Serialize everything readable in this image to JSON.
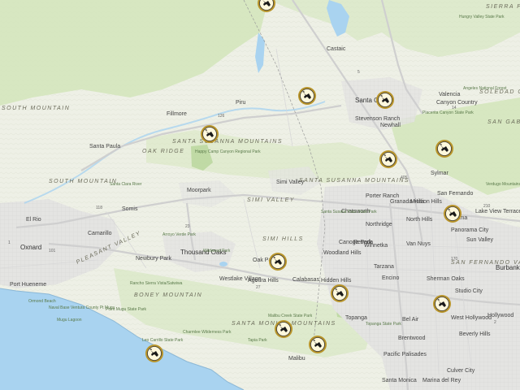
{
  "map": {
    "range_labels": [
      "SOUTH MOUNTAIN",
      "SANTA SUSANNA MOUNTAINS",
      "SOUTH MOUNTAIN",
      "SANTA SUSANNA MOUNTAINS",
      "SIMI VALLEY",
      "SIMI HILLS",
      "PLEASANT VALLEY",
      "BONEY MOUNTAIN",
      "SANTA MONICA MOUNTAINS",
      "SAN FERNANDO VALLEY",
      "SAN GABR",
      "SIERRA PELONA",
      "SOLEDAD CAN",
      "OAK RIDGE"
    ],
    "city_labels": [
      "Santa Paula",
      "Fillmore",
      "Piru",
      "Santa Clarita",
      "Stevenson Ranch",
      "Newhall",
      "Canyon Country",
      "Oxnard",
      "Camarillo",
      "Moorpark",
      "Simi Valley",
      "Somis",
      "El Rio",
      "Thousand Oaks",
      "Newbury Park",
      "Oak Park",
      "Agoura Hills",
      "Calabasas",
      "Hidden Hills",
      "Malibu",
      "Topanga",
      "Chatsworth",
      "Porter Ranch",
      "Northridge",
      "Granada Hills",
      "Sylmar",
      "San Fernando",
      "Pacoima",
      "North Hills",
      "Van Nuys",
      "Encino",
      "Tarzana",
      "Reseda",
      "Canoga Park",
      "Winnetka",
      "Sherman Oaks",
      "Studio City",
      "Burbank",
      "West Hollywood",
      "Beverly Hills",
      "Culver City",
      "Brentwood",
      "Pacific Palisades",
      "Port Hueneme",
      "Westlake Village",
      "Panorama City",
      "Sun Valley",
      "Woodland Hills",
      "Mission Hills",
      "Lake View Terrace",
      "Bel Air",
      "Marina del Rey",
      "Santa Monica",
      "Hollywood",
      "Valencia",
      "Castaic"
    ],
    "park_labels": [
      "Hungry Valley State Park",
      "Placerita Canyon State Park",
      "Happy Camp Canyon Regional Park",
      "Point Mugu State Park",
      "Topanga State Park",
      "Malibu Creek State Park",
      "Santa Susana Pass State Park",
      "Angeles National Forest",
      "Verdugo Mountains",
      "Ormond Beach",
      "Mugu Lagoon",
      "Leo Carrillo State Park",
      "Naval Base Ventura County Pt Mugu",
      "Arroyo Verde Park",
      "Santa Clara River",
      "Wildwood Park",
      "Rancho Sierra Vista/Satwiwa",
      "Charmlee Wilderness Park",
      "Tapia Park"
    ],
    "road_numbers": [
      "126",
      "118",
      "101",
      "23",
      "5",
      "14",
      "405",
      "170",
      "27",
      "1",
      "2",
      "210"
    ]
  },
  "markers": [
    {
      "name": "wildfire-marker-1",
      "icon": "fire-helicopter-icon"
    },
    {
      "name": "wildfire-marker-2",
      "icon": "fire-helicopter-icon"
    },
    {
      "name": "wildfire-marker-3",
      "icon": "fire-helicopter-icon"
    },
    {
      "name": "wildfire-marker-4",
      "icon": "fire-helicopter-icon"
    },
    {
      "name": "wildfire-marker-5",
      "icon": "fire-helicopter-icon"
    },
    {
      "name": "wildfire-marker-6",
      "icon": "fire-helicopter-icon"
    },
    {
      "name": "wildfire-marker-7",
      "icon": "fire-helicopter-icon"
    },
    {
      "name": "wildfire-marker-8",
      "icon": "fire-helicopter-icon"
    },
    {
      "name": "wildfire-marker-9",
      "icon": "fire-helicopter-icon"
    },
    {
      "name": "wildfire-marker-10",
      "icon": "fire-helicopter-icon"
    },
    {
      "name": "wildfire-marker-11",
      "icon": "fire-helicopter-icon"
    },
    {
      "name": "wildfire-marker-12",
      "icon": "fire-helicopter-icon"
    },
    {
      "name": "wildfire-marker-13",
      "icon": "fire-helicopter-icon"
    },
    {
      "name": "wildfire-marker-14",
      "icon": "fire-helicopter-icon"
    }
  ],
  "colors": {
    "ocean": "#a9d3f0",
    "land": "#eef0e6",
    "vegetation": "#cfe3b5",
    "urban": "#e2e2e2",
    "marker_ring": "#b8942a",
    "marker_fill": "#fff8dc"
  }
}
